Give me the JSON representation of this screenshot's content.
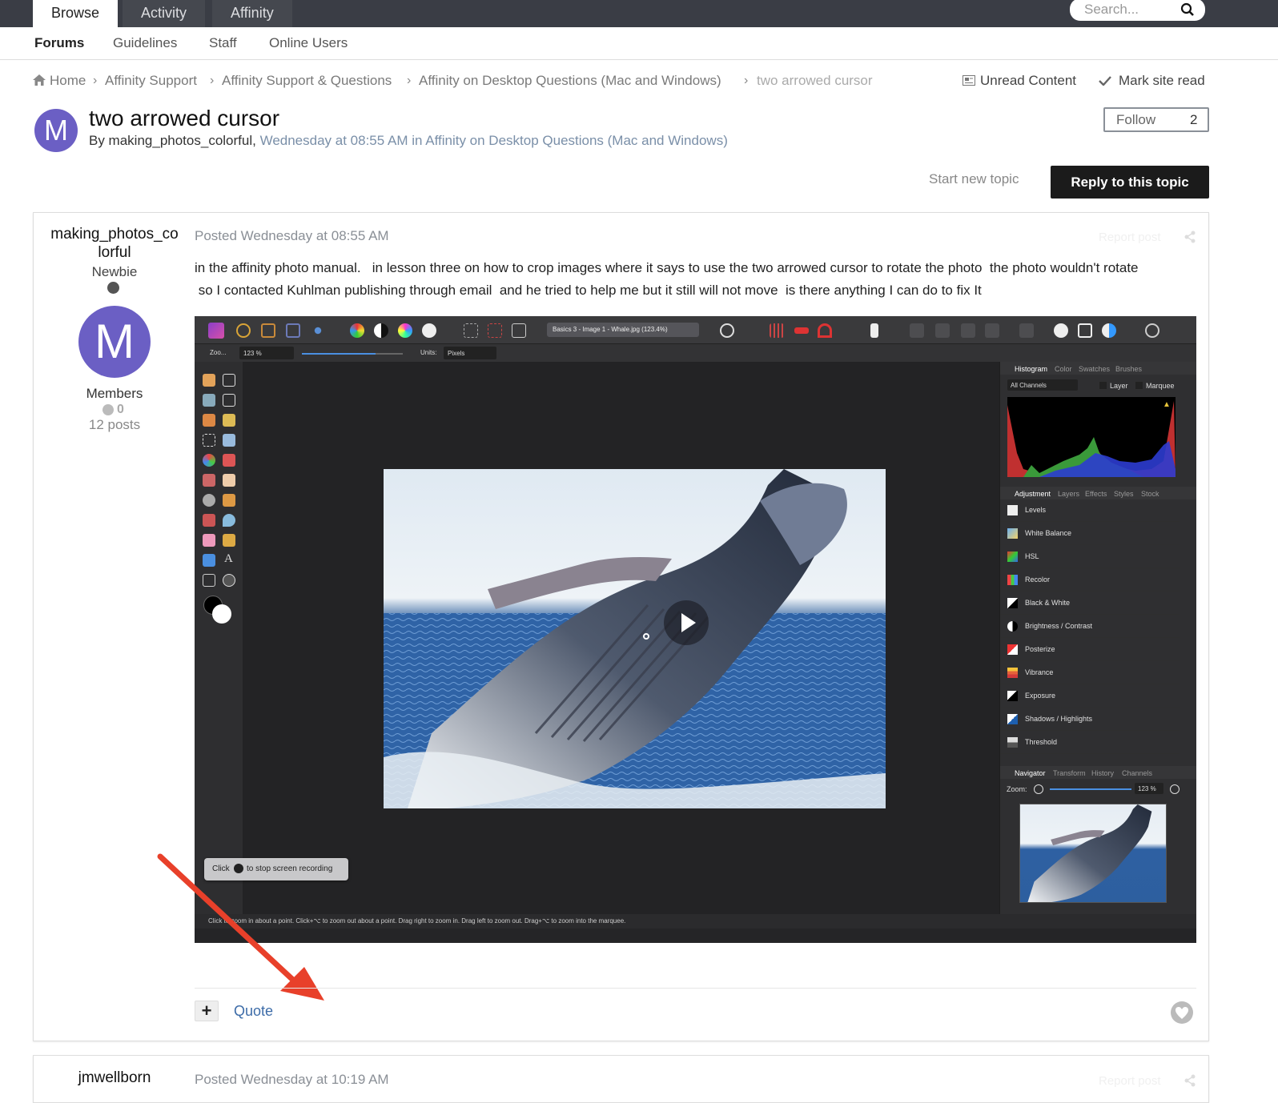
{
  "topnav": {
    "tabs": [
      "Browse",
      "Activity",
      "Affinity"
    ],
    "search_placeholder": "Search..."
  },
  "subnav": {
    "items": [
      "Forums",
      "Guidelines",
      "Staff",
      "Online Users"
    ]
  },
  "breadcrumb": {
    "items": [
      "Home",
      "Affinity Support",
      "Affinity Support & Questions",
      "Affinity on Desktop Questions (Mac and Windows)"
    ],
    "current": "two arrowed cursor",
    "unread": "Unread Content",
    "mark_read": "Mark site read"
  },
  "topic": {
    "avatar_letter": "M",
    "title": "two arrowed cursor",
    "by": "By making_photos_colorful,",
    "meta": "Wednesday at 08:55 AM in Affinity on Desktop Questions (Mac and Windows)",
    "follow_label": "Follow",
    "follow_count": "2",
    "start_new": "Start new topic",
    "reply": "Reply to this topic"
  },
  "post1": {
    "author_line1": "making_photos_co",
    "author_line2": "lorful",
    "rank": "Newbie",
    "avatar_letter": "M",
    "group": "Members",
    "rep": "0",
    "posts": "12 posts",
    "posted": "Posted Wednesday at 08:55 AM",
    "report": "Report post",
    "body_line1": "in the affinity photo manual.   in lesson three on how to crop images where it says to use the two arrowed cursor to rotate the photo  the photo wouldn't rotate",
    "body_line2": " so I contacted Kuhlman publishing through email  and he tried to help me but it still will not move  is there anything I can do to fix It",
    "quote": "Quote"
  },
  "app": {
    "doc_tab": "Basics 3 - Image 1 - Whale.jpg (123.4%)",
    "zoom_label": "Zoo...",
    "zoom_value": "123 %",
    "units_label": "Units:",
    "units_value": "Pixels",
    "histogram_tabs": [
      "Histogram",
      "Color",
      "Swatches",
      "Brushes"
    ],
    "channels": "All Channels",
    "layer": "Layer",
    "marquee": "Marquee",
    "adj_tabs": [
      "Adjustment",
      "Layers",
      "Effects",
      "Styles",
      "Stock"
    ],
    "adjustments": [
      "Levels",
      "White Balance",
      "HSL",
      "Recolor",
      "Black & White",
      "Brightness / Contrast",
      "Posterize",
      "Vibrance",
      "Exposure",
      "Shadows / Highlights",
      "Threshold"
    ],
    "nav_tabs": [
      "Navigator",
      "Transform",
      "History",
      "Channels"
    ],
    "nav_zoom_label": "Zoom:",
    "nav_zoom_value": "123 %",
    "recording_left": "Click",
    "recording_right": "to stop screen recording",
    "status": "Click to zoom in about a point. Click+⌥ to zoom out about a point. Drag right to zoom in. Drag left to zoom out. Drag+⌥ to zoom into the marquee."
  },
  "post2": {
    "author": "jmwellborn",
    "posted": "Posted Wednesday at 10:19 AM",
    "report": "Report post"
  },
  "colors": {
    "accent": "#6b5fc4",
    "dark": "#1b1b1b",
    "arrow": "#e8402a",
    "link": "#3d6ca8"
  }
}
